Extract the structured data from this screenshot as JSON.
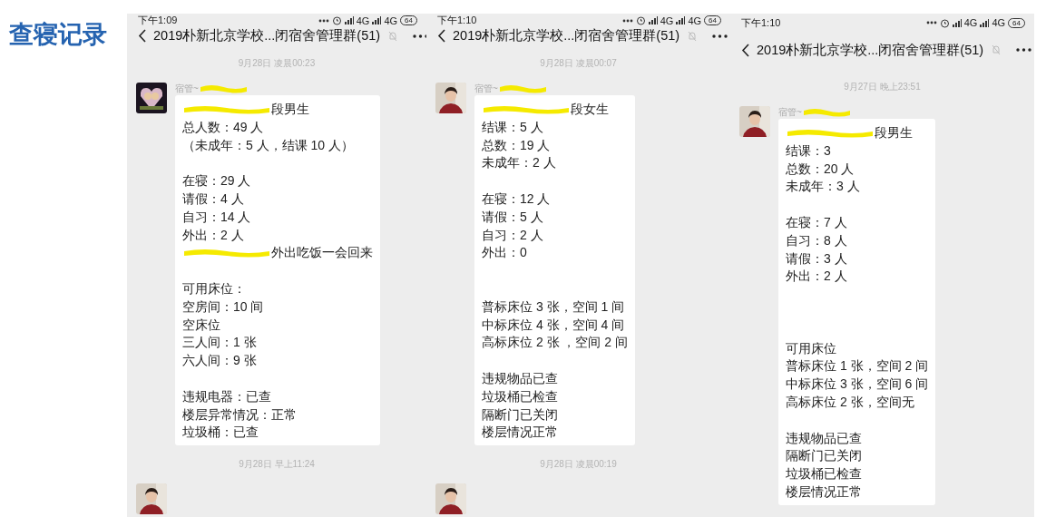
{
  "page_title": "查寝记录",
  "phones": [
    {
      "status_bar": {
        "time": "下午1:09",
        "network_labels": [
          "4G",
          "4G"
        ],
        "battery": "64"
      },
      "header": {
        "title": "2019朴新北京学校...闭宿舍管理群(51)"
      },
      "items": [
        {
          "kind": "timestamp",
          "text": "9月28日 凌晨00:23"
        },
        {
          "kind": "message",
          "sender": "宿管~",
          "lines": [
            {
              "kind": "redacted",
              "text": "段男生"
            },
            {
              "kind": "text",
              "text": "总人数：49 人"
            },
            {
              "kind": "text",
              "text": "（未成年：5 人，结课 10 人）"
            },
            {
              "kind": "blank"
            },
            {
              "kind": "text",
              "text": "在寝：29 人"
            },
            {
              "kind": "text",
              "text": "请假：4 人"
            },
            {
              "kind": "text",
              "text": "自习：14 人"
            },
            {
              "kind": "text",
              "text": "外出：2 人"
            },
            {
              "kind": "redacted",
              "text": "外出吃饭一会回来"
            },
            {
              "kind": "blank"
            },
            {
              "kind": "text",
              "text": "可用床位："
            },
            {
              "kind": "text",
              "text": "空房间：10 间"
            },
            {
              "kind": "text",
              "text": "空床位"
            },
            {
              "kind": "text",
              "text": "三人间：1 张"
            },
            {
              "kind": "text",
              "text": "六人间：9 张"
            },
            {
              "kind": "blank"
            },
            {
              "kind": "text",
              "text": "违规电器：已查"
            },
            {
              "kind": "text",
              "text": "楼层异常情况：正常"
            },
            {
              "kind": "text",
              "text": "垃圾桶：已查"
            }
          ]
        },
        {
          "kind": "timestamp",
          "text": "9月28日 早上11:24"
        },
        {
          "kind": "avatar"
        }
      ]
    },
    {
      "status_bar": {
        "time": "下午1:10",
        "network_labels": [
          "4G",
          "4G"
        ],
        "battery": "64"
      },
      "header": {
        "title": "2019朴新北京学校...闭宿舍管理群(51)"
      },
      "items": [
        {
          "kind": "timestamp",
          "text": "9月28日 凌晨00:07"
        },
        {
          "kind": "message",
          "sender": "宿管~",
          "lines": [
            {
              "kind": "redacted",
              "text": "段女生"
            },
            {
              "kind": "text",
              "text": "结课：5 人"
            },
            {
              "kind": "text",
              "text": "总数：19 人"
            },
            {
              "kind": "text",
              "text": "未成年：2 人"
            },
            {
              "kind": "blank"
            },
            {
              "kind": "text",
              "text": "在寝：12 人"
            },
            {
              "kind": "text",
              "text": "请假：5 人"
            },
            {
              "kind": "text",
              "text": "自习：2 人"
            },
            {
              "kind": "text",
              "text": "外出：0"
            },
            {
              "kind": "blank"
            },
            {
              "kind": "blank"
            },
            {
              "kind": "text",
              "text": "普标床位 3 张，空间 1 间"
            },
            {
              "kind": "text",
              "text": "中标床位 4 张，空间 4 间"
            },
            {
              "kind": "text",
              "text": "高标床位 2 张 ，空间 2 间"
            },
            {
              "kind": "blank"
            },
            {
              "kind": "text",
              "text": "违规物品已查"
            },
            {
              "kind": "text",
              "text": "垃圾桶已检查"
            },
            {
              "kind": "text",
              "text": "隔断门已关闭"
            },
            {
              "kind": "text",
              "text": "楼层情况正常"
            }
          ]
        },
        {
          "kind": "timestamp",
          "text": "9月28日 凌晨00:19"
        },
        {
          "kind": "avatar"
        }
      ]
    },
    {
      "status_bar": {
        "time": "下午1:10",
        "network_labels": [
          "4G",
          "4G"
        ],
        "battery": "64"
      },
      "header": {
        "title": "2019朴新北京学校...闭宿舍管理群(51)"
      },
      "items": [
        {
          "kind": "timestamp",
          "text": "9月27日 晚上23:51"
        },
        {
          "kind": "message",
          "sender": "宿管~",
          "lines": [
            {
              "kind": "redacted",
              "text": "段男生"
            },
            {
              "kind": "text",
              "text": "结课：3"
            },
            {
              "kind": "text",
              "text": "总数：20 人"
            },
            {
              "kind": "text",
              "text": "未成年：3 人"
            },
            {
              "kind": "blank"
            },
            {
              "kind": "text",
              "text": "在寝：7 人"
            },
            {
              "kind": "text",
              "text": "自习：8 人"
            },
            {
              "kind": "text",
              "text": "请假：3 人"
            },
            {
              "kind": "text",
              "text": "外出：2 人"
            },
            {
              "kind": "blank"
            },
            {
              "kind": "blank"
            },
            {
              "kind": "blank"
            },
            {
              "kind": "text",
              "text": "可用床位"
            },
            {
              "kind": "text",
              "text": "普标床位 1 张，空间 2 间"
            },
            {
              "kind": "text",
              "text": "中标床位 3 张，空间 6 间"
            },
            {
              "kind": "text",
              "text": "高标床位 2 张，空间无"
            },
            {
              "kind": "blank"
            },
            {
              "kind": "text",
              "text": "违规物品已查"
            },
            {
              "kind": "text",
              "text": "隔断门已关闭"
            },
            {
              "kind": "text",
              "text": "垃圾桶已检查"
            },
            {
              "kind": "text",
              "text": "楼层情况正常"
            }
          ]
        }
      ]
    }
  ]
}
